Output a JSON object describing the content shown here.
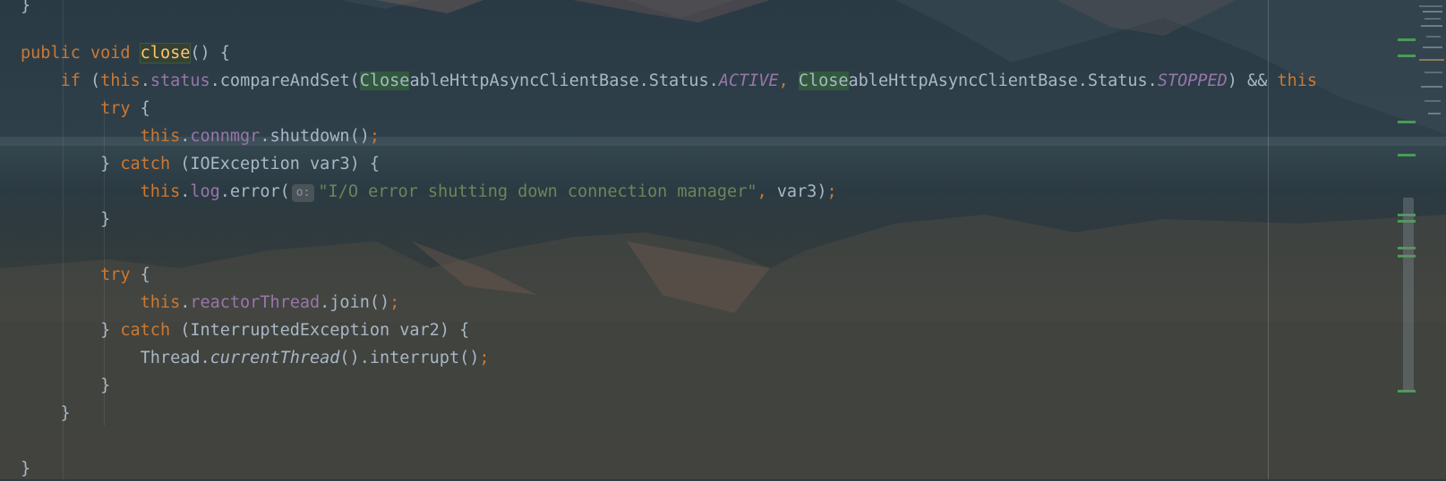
{
  "editor": {
    "lines": [
      {
        "segments": [
          {
            "t": "}",
            "c": ""
          }
        ]
      },
      {
        "segments": [
          {
            "t": "public",
            "c": "kw"
          },
          {
            "t": " ",
            "c": ""
          },
          {
            "t": "void",
            "c": "kw"
          },
          {
            "t": " ",
            "c": ""
          },
          {
            "t": "close",
            "c": "fn hl-y"
          },
          {
            "t": "() {",
            "c": ""
          }
        ]
      },
      {
        "segments": [
          {
            "t": "    ",
            "c": ""
          },
          {
            "t": "if",
            "c": "kw"
          },
          {
            "t": " (",
            "c": ""
          },
          {
            "t": "this",
            "c": "kw"
          },
          {
            "t": ".",
            "c": ""
          },
          {
            "t": "status",
            "c": "fld"
          },
          {
            "t": ".compareAndSet(",
            "c": ""
          },
          {
            "t": "Close",
            "c": "hl"
          },
          {
            "t": "ableHttpAsyncClientBase.Status.",
            "c": ""
          },
          {
            "t": "ACTIVE",
            "c": "const"
          },
          {
            "t": ", ",
            "c": "kw"
          },
          {
            "t": "Close",
            "c": "hl"
          },
          {
            "t": "ableHttpAsyncClientBase.Status.",
            "c": ""
          },
          {
            "t": "STOPPED",
            "c": "const"
          },
          {
            "t": ") && ",
            "c": ""
          },
          {
            "t": "this",
            "c": "kw"
          }
        ]
      },
      {
        "segments": [
          {
            "t": "        ",
            "c": ""
          },
          {
            "t": "try",
            "c": "kw"
          },
          {
            "t": " {",
            "c": ""
          }
        ]
      },
      {
        "segments": [
          {
            "t": "            ",
            "c": ""
          },
          {
            "t": "this",
            "c": "kw"
          },
          {
            "t": ".",
            "c": ""
          },
          {
            "t": "connmgr",
            "c": "fld"
          },
          {
            "t": ".shutdown()",
            "c": ""
          },
          {
            "t": ";",
            "c": "kw"
          }
        ]
      },
      {
        "segments": [
          {
            "t": "        } ",
            "c": ""
          },
          {
            "t": "catch",
            "c": "kw"
          },
          {
            "t": " (IOException var3) {",
            "c": ""
          }
        ]
      },
      {
        "segments": [
          {
            "t": "            ",
            "c": ""
          },
          {
            "t": "this",
            "c": "kw"
          },
          {
            "t": ".",
            "c": ""
          },
          {
            "t": "log",
            "c": "fld"
          },
          {
            "t": ".error(",
            "c": ""
          },
          {
            "t": "o:",
            "c": "hint"
          },
          {
            "t": "\"I/O error shutting down connection manager\"",
            "c": "str"
          },
          {
            "t": ", ",
            "c": "kw"
          },
          {
            "t": "var3)",
            "c": ""
          },
          {
            "t": ";",
            "c": "kw"
          }
        ]
      },
      {
        "segments": [
          {
            "t": "        }",
            "c": ""
          }
        ]
      },
      {
        "segments": [
          {
            "t": "",
            "c": ""
          }
        ]
      },
      {
        "segments": [
          {
            "t": "        ",
            "c": ""
          },
          {
            "t": "try",
            "c": "kw"
          },
          {
            "t": " {",
            "c": ""
          }
        ]
      },
      {
        "segments": [
          {
            "t": "            ",
            "c": ""
          },
          {
            "t": "this",
            "c": "kw"
          },
          {
            "t": ".",
            "c": ""
          },
          {
            "t": "reactorThread",
            "c": "fld"
          },
          {
            "t": ".join()",
            "c": ""
          },
          {
            "t": ";",
            "c": "kw"
          }
        ]
      },
      {
        "segments": [
          {
            "t": "        } ",
            "c": ""
          },
          {
            "t": "catch",
            "c": "kw"
          },
          {
            "t": " (InterruptedException var2) {",
            "c": ""
          }
        ]
      },
      {
        "segments": [
          {
            "t": "            Thread.",
            "c": ""
          },
          {
            "t": "currentThread",
            "c": "it"
          },
          {
            "t": "().interrupt()",
            "c": ""
          },
          {
            "t": ";",
            "c": "kw"
          }
        ]
      },
      {
        "segments": [
          {
            "t": "        }",
            "c": ""
          }
        ]
      },
      {
        "segments": [
          {
            "t": "    }",
            "c": ""
          }
        ]
      },
      {
        "segments": [
          {
            "t": "",
            "c": ""
          }
        ]
      },
      {
        "segments": [
          {
            "t": "}",
            "c": ""
          }
        ]
      }
    ]
  },
  "colors": {
    "keyword": "#cc7832",
    "field": "#9876aa",
    "string": "#6a8759",
    "method_decl": "#ffc66d",
    "default_text": "#a9b7c6",
    "highlight": "#32593d",
    "stripe_marker": "#499c54"
  }
}
